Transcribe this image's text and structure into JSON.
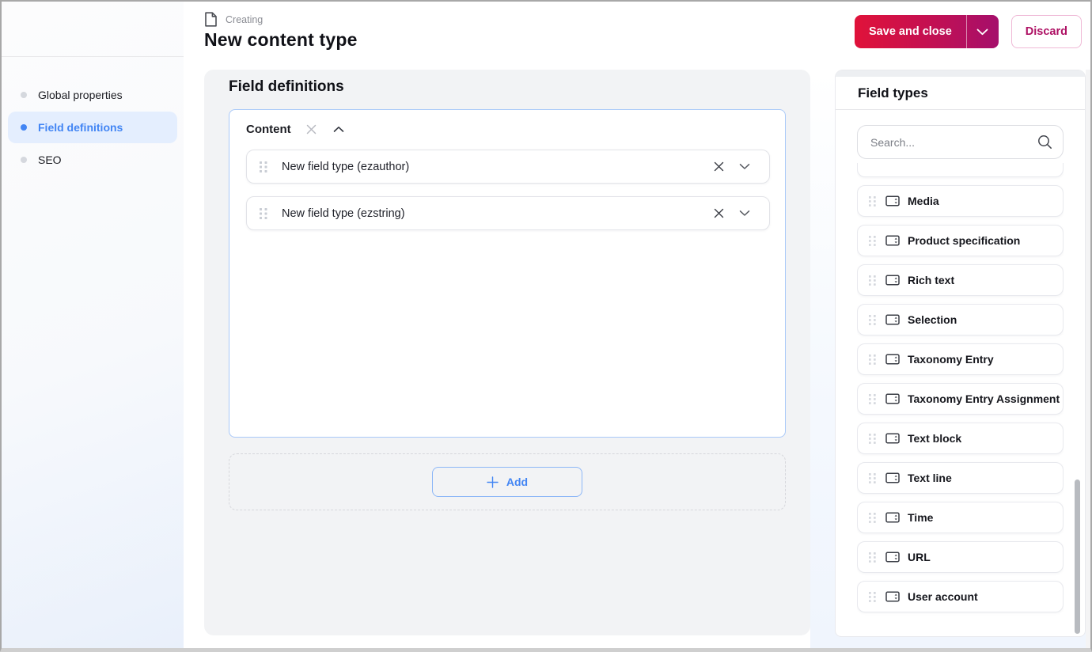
{
  "header": {
    "kicker": "Creating",
    "title": "New content type",
    "save_label": "Save and close",
    "discard_label": "Discard"
  },
  "sidebar": {
    "items": [
      {
        "label": "Global properties",
        "active": false
      },
      {
        "label": "Field definitions",
        "active": true
      },
      {
        "label": "SEO",
        "active": false
      }
    ]
  },
  "main": {
    "section_title": "Field definitions",
    "group": {
      "name": "Content",
      "fields": [
        {
          "label": "New field type (ezauthor)"
        },
        {
          "label": "New field type (ezstring)"
        }
      ]
    },
    "add_label": "Add"
  },
  "panel": {
    "title": "Field types",
    "search_placeholder": "Search...",
    "items": [
      "Media",
      "Product specification",
      "Rich text",
      "Selection",
      "Taxonomy Entry",
      "Taxonomy Entry Assignment",
      "Text block",
      "Text line",
      "Time",
      "URL",
      "User account"
    ]
  },
  "colors": {
    "accent_gradient_start": "#e0123a",
    "accent_gradient_end": "#a50f6b",
    "discard_text": "#ae1164",
    "active_blue": "#4285f4",
    "active_item_bg": "#e4eefe",
    "panel_bg": "#f2f3f5"
  }
}
